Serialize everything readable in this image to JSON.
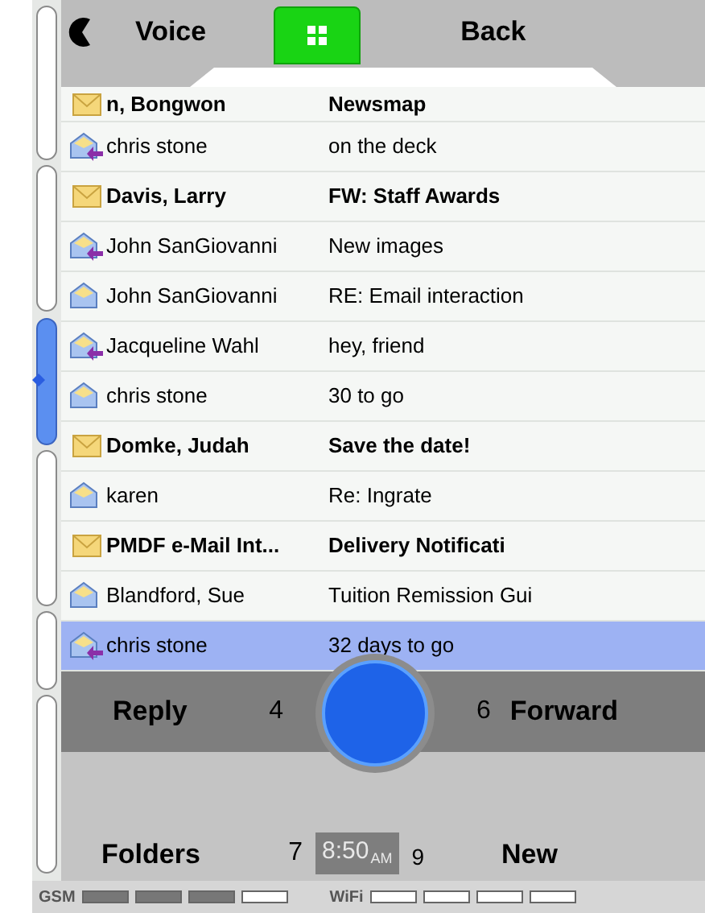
{
  "header": {
    "left_label": "Voice",
    "right_label": "Back"
  },
  "messages": [
    {
      "sender": "n, Bongwon",
      "subject": "Newsmap",
      "unread": true,
      "replied": false,
      "selected": false
    },
    {
      "sender": "chris stone",
      "subject": "on the deck",
      "unread": false,
      "replied": true,
      "selected": false
    },
    {
      "sender": "Davis, Larry",
      "subject": "FW: Staff Awards",
      "unread": true,
      "replied": false,
      "selected": false
    },
    {
      "sender": "John SanGiovanni",
      "subject": "New images",
      "unread": false,
      "replied": true,
      "selected": false
    },
    {
      "sender": "John SanGiovanni",
      "subject": "RE: Email interaction",
      "unread": false,
      "replied": false,
      "selected": false
    },
    {
      "sender": "Jacqueline Wahl",
      "subject": "hey, friend",
      "unread": false,
      "replied": true,
      "selected": false
    },
    {
      "sender": "chris stone",
      "subject": "30 to go",
      "unread": false,
      "replied": false,
      "selected": false
    },
    {
      "sender": "Domke, Judah",
      "subject": "Save the date!",
      "unread": true,
      "replied": false,
      "selected": false
    },
    {
      "sender": "karen",
      "subject": "Re: Ingrate",
      "unread": false,
      "replied": false,
      "selected": false
    },
    {
      "sender": "PMDF e-Mail Int...",
      "subject": "Delivery Notificati",
      "unread": true,
      "replied": false,
      "selected": false
    },
    {
      "sender": "Blandford, Sue",
      "subject": "Tuition Remission Gui",
      "unread": false,
      "replied": false,
      "selected": false
    },
    {
      "sender": "chris stone",
      "subject": "32 days to go",
      "unread": false,
      "replied": true,
      "selected": true
    }
  ],
  "softkeys": {
    "top_left": "Reply",
    "top_left_key": "4",
    "top_right_key": "6",
    "top_right": "Forward",
    "bottom_left": "Folders",
    "bottom_left_key": "7",
    "time": "8:50",
    "ampm": "AM",
    "bottom_right_key": "9",
    "bottom_right": "New"
  },
  "status_bar": {
    "gsm_label": "GSM",
    "wifi_label": "WiFi"
  }
}
